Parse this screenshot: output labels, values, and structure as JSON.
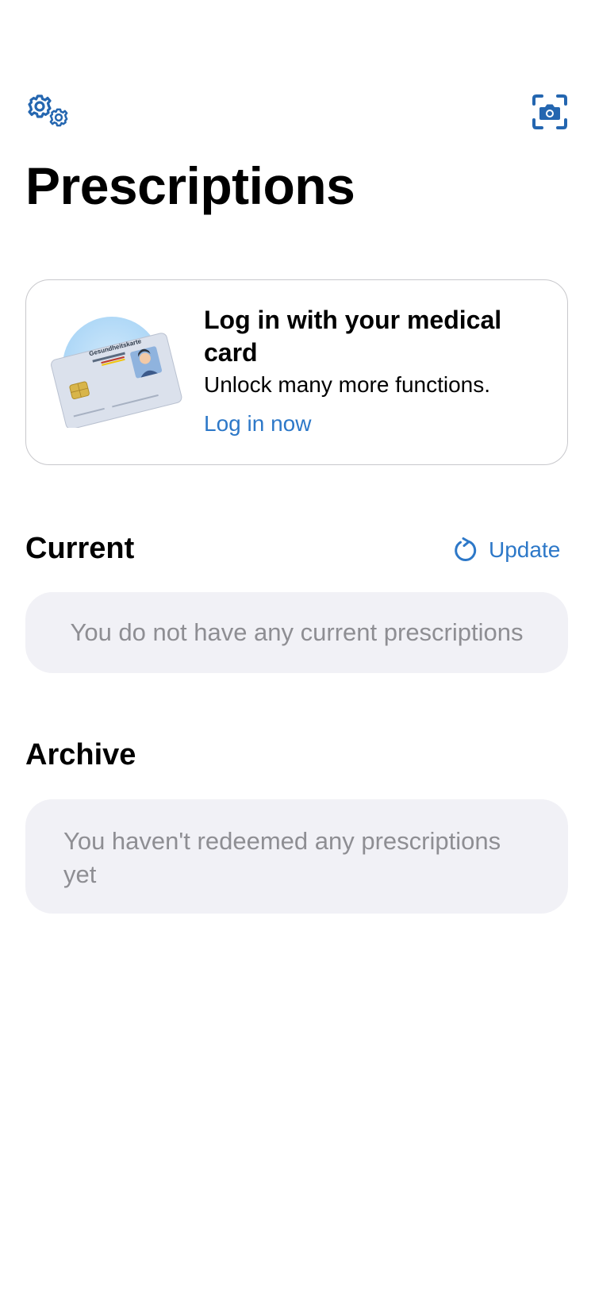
{
  "header": {
    "settings_icon": "gears-icon",
    "scan_icon": "camera-scan-icon",
    "title": "Prescriptions"
  },
  "login_card": {
    "illustration": "health-card-illustration",
    "card_text": "Gesundheitskarte",
    "title": "Log in with your medical card",
    "subtitle": "Unlock many more functions.",
    "link": "Log in now"
  },
  "current": {
    "title": "Current",
    "update_icon": "refresh-icon",
    "update_label": "Update",
    "empty_text": "You do not have any current prescriptions"
  },
  "archive": {
    "title": "Archive",
    "empty_text": "You haven't redeemed any prescriptions yet"
  },
  "colors": {
    "accent": "#2d78c8",
    "icon_blue": "#2466b0",
    "muted_text": "#8e8e93",
    "empty_bg": "#f1f1f6"
  }
}
